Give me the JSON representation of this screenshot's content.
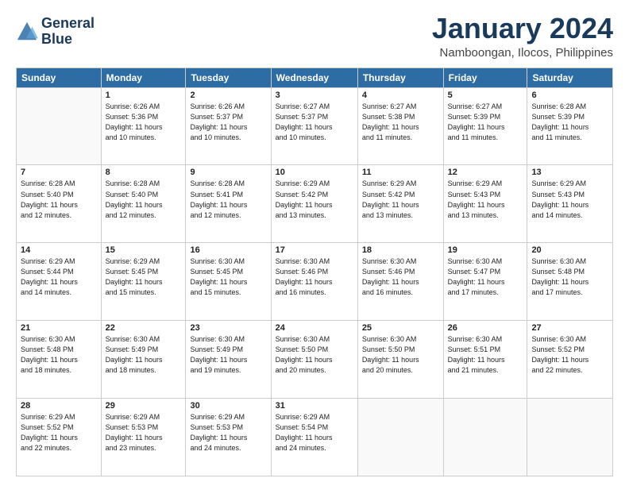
{
  "logo": {
    "line1": "General",
    "line2": "Blue"
  },
  "title": "January 2024",
  "subtitle": "Namboongan, Ilocos, Philippines",
  "headers": [
    "Sunday",
    "Monday",
    "Tuesday",
    "Wednesday",
    "Thursday",
    "Friday",
    "Saturday"
  ],
  "weeks": [
    [
      {
        "day": "",
        "info": ""
      },
      {
        "day": "1",
        "info": "Sunrise: 6:26 AM\nSunset: 5:36 PM\nDaylight: 11 hours\nand 10 minutes."
      },
      {
        "day": "2",
        "info": "Sunrise: 6:26 AM\nSunset: 5:37 PM\nDaylight: 11 hours\nand 10 minutes."
      },
      {
        "day": "3",
        "info": "Sunrise: 6:27 AM\nSunset: 5:37 PM\nDaylight: 11 hours\nand 10 minutes."
      },
      {
        "day": "4",
        "info": "Sunrise: 6:27 AM\nSunset: 5:38 PM\nDaylight: 11 hours\nand 11 minutes."
      },
      {
        "day": "5",
        "info": "Sunrise: 6:27 AM\nSunset: 5:39 PM\nDaylight: 11 hours\nand 11 minutes."
      },
      {
        "day": "6",
        "info": "Sunrise: 6:28 AM\nSunset: 5:39 PM\nDaylight: 11 hours\nand 11 minutes."
      }
    ],
    [
      {
        "day": "7",
        "info": "Sunrise: 6:28 AM\nSunset: 5:40 PM\nDaylight: 11 hours\nand 12 minutes."
      },
      {
        "day": "8",
        "info": "Sunrise: 6:28 AM\nSunset: 5:40 PM\nDaylight: 11 hours\nand 12 minutes."
      },
      {
        "day": "9",
        "info": "Sunrise: 6:28 AM\nSunset: 5:41 PM\nDaylight: 11 hours\nand 12 minutes."
      },
      {
        "day": "10",
        "info": "Sunrise: 6:29 AM\nSunset: 5:42 PM\nDaylight: 11 hours\nand 13 minutes."
      },
      {
        "day": "11",
        "info": "Sunrise: 6:29 AM\nSunset: 5:42 PM\nDaylight: 11 hours\nand 13 minutes."
      },
      {
        "day": "12",
        "info": "Sunrise: 6:29 AM\nSunset: 5:43 PM\nDaylight: 11 hours\nand 13 minutes."
      },
      {
        "day": "13",
        "info": "Sunrise: 6:29 AM\nSunset: 5:43 PM\nDaylight: 11 hours\nand 14 minutes."
      }
    ],
    [
      {
        "day": "14",
        "info": "Sunrise: 6:29 AM\nSunset: 5:44 PM\nDaylight: 11 hours\nand 14 minutes."
      },
      {
        "day": "15",
        "info": "Sunrise: 6:29 AM\nSunset: 5:45 PM\nDaylight: 11 hours\nand 15 minutes."
      },
      {
        "day": "16",
        "info": "Sunrise: 6:30 AM\nSunset: 5:45 PM\nDaylight: 11 hours\nand 15 minutes."
      },
      {
        "day": "17",
        "info": "Sunrise: 6:30 AM\nSunset: 5:46 PM\nDaylight: 11 hours\nand 16 minutes."
      },
      {
        "day": "18",
        "info": "Sunrise: 6:30 AM\nSunset: 5:46 PM\nDaylight: 11 hours\nand 16 minutes."
      },
      {
        "day": "19",
        "info": "Sunrise: 6:30 AM\nSunset: 5:47 PM\nDaylight: 11 hours\nand 17 minutes."
      },
      {
        "day": "20",
        "info": "Sunrise: 6:30 AM\nSunset: 5:48 PM\nDaylight: 11 hours\nand 17 minutes."
      }
    ],
    [
      {
        "day": "21",
        "info": "Sunrise: 6:30 AM\nSunset: 5:48 PM\nDaylight: 11 hours\nand 18 minutes."
      },
      {
        "day": "22",
        "info": "Sunrise: 6:30 AM\nSunset: 5:49 PM\nDaylight: 11 hours\nand 18 minutes."
      },
      {
        "day": "23",
        "info": "Sunrise: 6:30 AM\nSunset: 5:49 PM\nDaylight: 11 hours\nand 19 minutes."
      },
      {
        "day": "24",
        "info": "Sunrise: 6:30 AM\nSunset: 5:50 PM\nDaylight: 11 hours\nand 20 minutes."
      },
      {
        "day": "25",
        "info": "Sunrise: 6:30 AM\nSunset: 5:50 PM\nDaylight: 11 hours\nand 20 minutes."
      },
      {
        "day": "26",
        "info": "Sunrise: 6:30 AM\nSunset: 5:51 PM\nDaylight: 11 hours\nand 21 minutes."
      },
      {
        "day": "27",
        "info": "Sunrise: 6:30 AM\nSunset: 5:52 PM\nDaylight: 11 hours\nand 22 minutes."
      }
    ],
    [
      {
        "day": "28",
        "info": "Sunrise: 6:29 AM\nSunset: 5:52 PM\nDaylight: 11 hours\nand 22 minutes."
      },
      {
        "day": "29",
        "info": "Sunrise: 6:29 AM\nSunset: 5:53 PM\nDaylight: 11 hours\nand 23 minutes."
      },
      {
        "day": "30",
        "info": "Sunrise: 6:29 AM\nSunset: 5:53 PM\nDaylight: 11 hours\nand 24 minutes."
      },
      {
        "day": "31",
        "info": "Sunrise: 6:29 AM\nSunset: 5:54 PM\nDaylight: 11 hours\nand 24 minutes."
      },
      {
        "day": "",
        "info": ""
      },
      {
        "day": "",
        "info": ""
      },
      {
        "day": "",
        "info": ""
      }
    ]
  ]
}
